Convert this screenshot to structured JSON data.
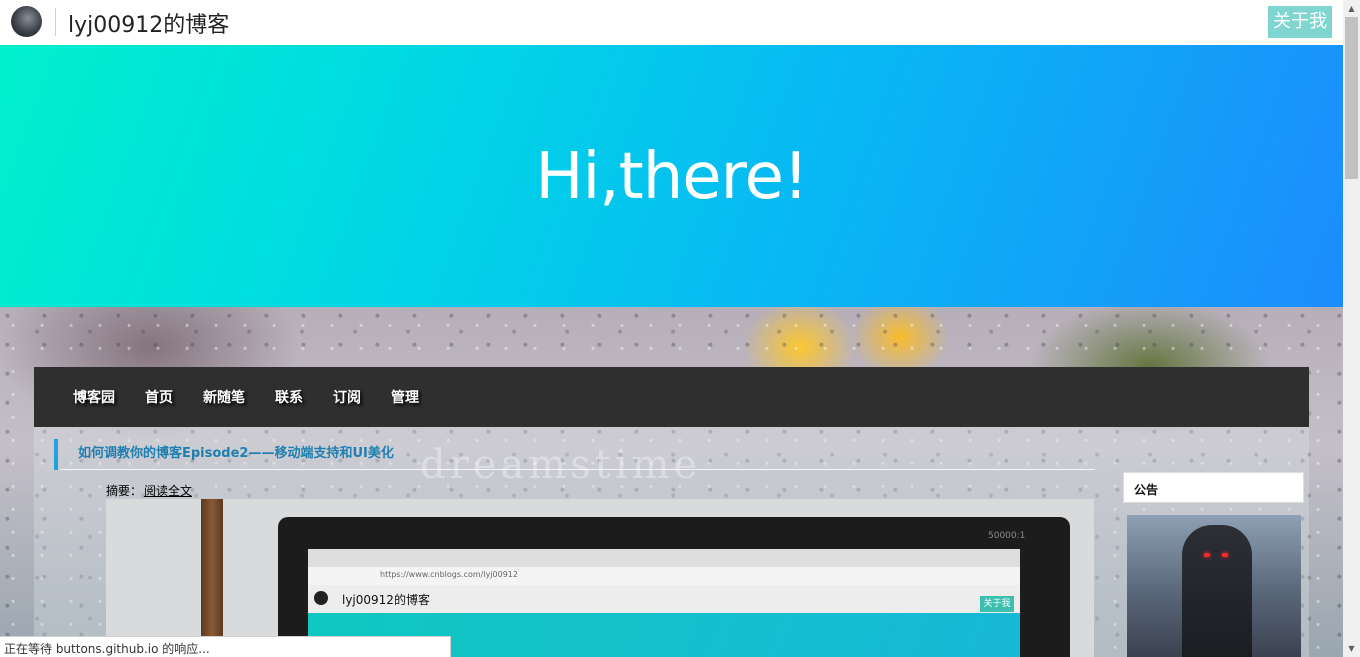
{
  "header": {
    "site_title": "lyj00912的博客",
    "about_label": "关于我",
    "avatar_icon": "avatar"
  },
  "hero": {
    "text": "Hi,there!",
    "gradient_colors": [
      "#00f0cc",
      "#1c8cfc"
    ]
  },
  "nav": {
    "items": [
      {
        "label": "博客园"
      },
      {
        "label": "首页"
      },
      {
        "label": "新随笔"
      },
      {
        "label": "联系"
      },
      {
        "label": "订阅"
      },
      {
        "label": "管理"
      }
    ]
  },
  "post": {
    "title": "如何调教你的博客Episode2——移动端支持和UI美化",
    "summary_label": "摘要：",
    "read_more": "阅读全文",
    "watermark": "dreamstime",
    "photo": {
      "monitor_logo": "50000:1",
      "address": "https://www.cnblogs.com/lyj00912",
      "inner_title": "lyj00912的博客",
      "inner_about": "关于我"
    }
  },
  "sidebar": {
    "notice_title": "公告"
  },
  "status": {
    "text": "正在等待 buttons.github.io 的响应..."
  },
  "colors": {
    "accent_bar": "#1fa3e0",
    "about_button": "#7fd5d0",
    "nav_bg": "#2f2f2f"
  }
}
